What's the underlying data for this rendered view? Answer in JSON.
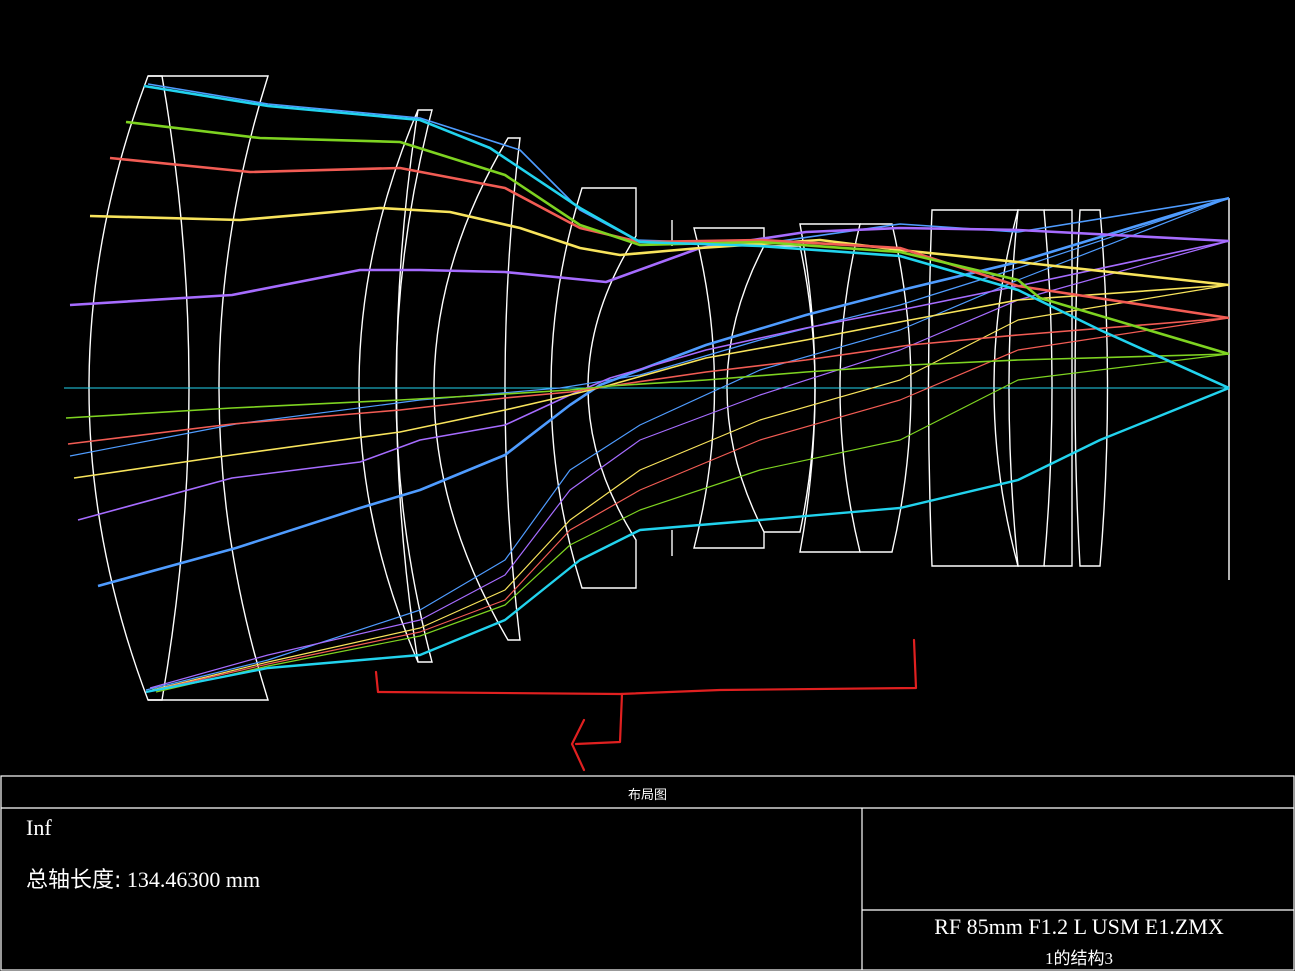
{
  "title_block": {
    "plot_title": "布局图",
    "field_label": "Inf",
    "axis_length_label": "总轴长度:",
    "axis_length_value": "134.46300 mm",
    "file_name": "RF 85mm F1.2 L USM E1.ZMX",
    "config_label": "1的结构3"
  },
  "colors": {
    "background": "#000000",
    "lens_outline": "#ffffff",
    "annotation": "#e02020",
    "field_1": "#22d3ee",
    "field_2": "#7ed321",
    "field_3": "#f25c54",
    "field_4": "#f8e45c",
    "field_5": "#a66cff",
    "field_6": "#4f9cff"
  },
  "diagram": {
    "type": "optical-layout",
    "field_colors": [
      "#4f9cff",
      "#a66cff",
      "#f8e45c",
      "#f25c54",
      "#7ed321",
      "#22d3ee"
    ]
  }
}
